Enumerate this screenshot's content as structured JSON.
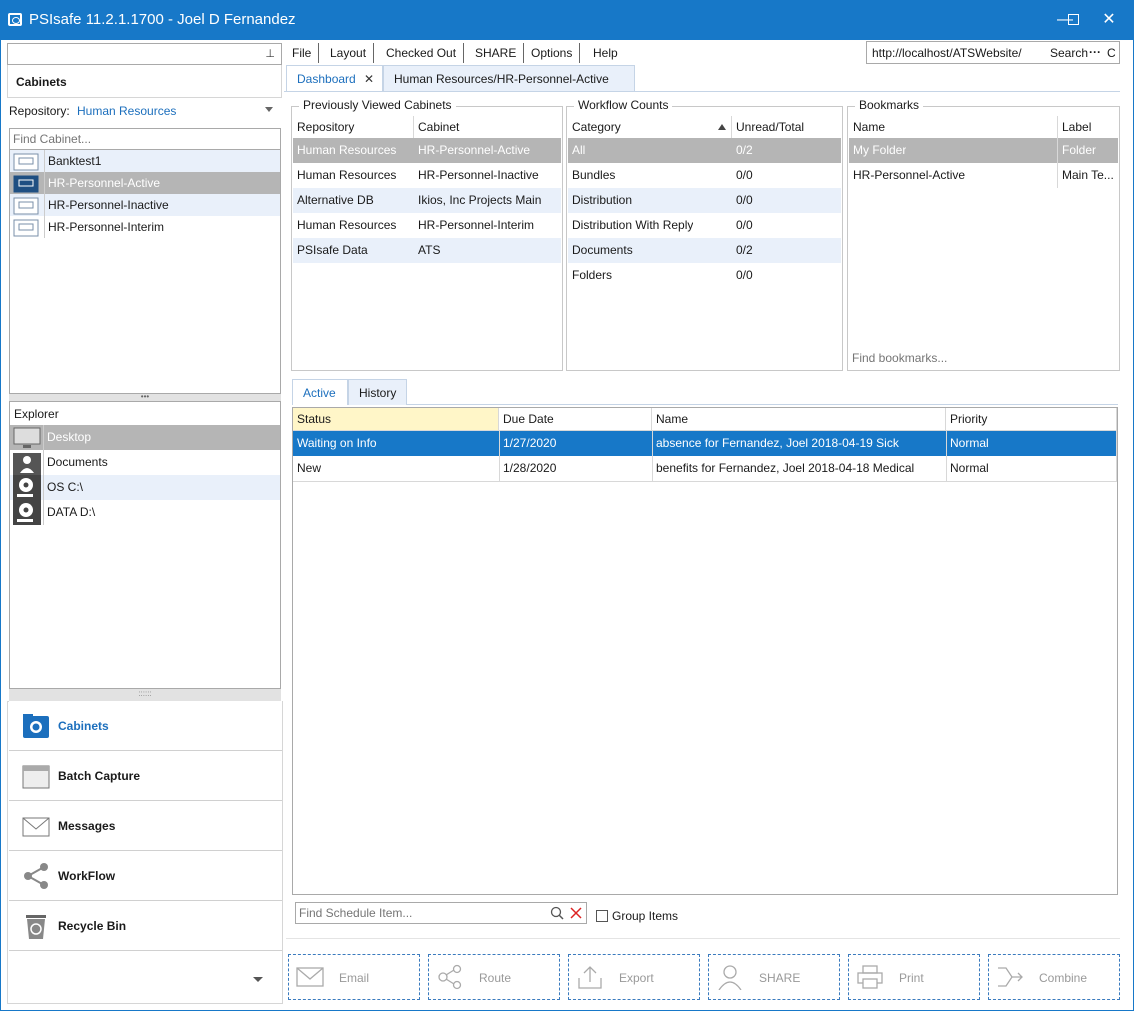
{
  "window": {
    "title": "PSIsafe 11.2.1.1700 - Joel D Fernandez",
    "minimize_glyph": "—",
    "maximize_glyph": "☐",
    "close_glyph": "✕"
  },
  "left_panel": {
    "pin_glyph": "📌",
    "cabinets_header": "Cabinets",
    "repository_label": "Repository:",
    "repository_value": "Human Resources",
    "find_cabinet_placeholder": "Find Cabinet...",
    "cabinets": [
      {
        "name": "Banktest1"
      },
      {
        "name": "HR-Personnel-Active"
      },
      {
        "name": "HR-Personnel-Inactive"
      },
      {
        "name": "HR-Personnel-Interim"
      }
    ],
    "explorer_header": "Explorer",
    "explorer_items": [
      {
        "name": "Desktop",
        "icon": "monitor-icon"
      },
      {
        "name": "Documents",
        "icon": "user-folder-icon"
      },
      {
        "name": "OS C:\\",
        "icon": "disk-icon"
      },
      {
        "name": "DATA D:\\",
        "icon": "disk-icon"
      }
    ],
    "nav_buttons": [
      {
        "label": "Cabinets",
        "icon": "cabinet-icon"
      },
      {
        "label": "Batch Capture",
        "icon": "scanner-icon"
      },
      {
        "label": "Messages",
        "icon": "envelope-icon"
      },
      {
        "label": "WorkFlow",
        "icon": "share-icon"
      },
      {
        "label": "Recycle Bin",
        "icon": "recycle-bin-icon"
      }
    ]
  },
  "menu": {
    "items": [
      "File",
      "Layout",
      "Checked Out",
      "SHARE",
      "Options",
      "Help"
    ],
    "url": "http://localhost/ATSWebsite/",
    "search_label": "Search",
    "more_glyph": "···",
    "c_glyph": "C"
  },
  "tabs": [
    {
      "label": "Dashboard",
      "close": "✕"
    },
    {
      "label": "Human Resources/HR-Personnel-Active"
    }
  ],
  "previously_viewed": {
    "title": "Previously Viewed Cabinets",
    "columns": [
      "Repository",
      "Cabinet"
    ],
    "rows": [
      [
        "Human Resources",
        "HR-Personnel-Active"
      ],
      [
        "Human Resources",
        "HR-Personnel-Inactive"
      ],
      [
        "Alternative DB",
        "Ikios, Inc Projects Main"
      ],
      [
        "Human Resources",
        "HR-Personnel-Interim"
      ],
      [
        "PSIsafe Data",
        "ATS"
      ]
    ]
  },
  "workflow_counts": {
    "title": "Workflow Counts",
    "columns": [
      "Category",
      "Unread/Total"
    ],
    "rows": [
      [
        "All",
        "0/2"
      ],
      [
        "Bundles",
        "0/0"
      ],
      [
        "Distribution",
        "0/0"
      ],
      [
        "Distribution With Reply",
        "0/0"
      ],
      [
        "Documents",
        "0/2"
      ],
      [
        "Folders",
        "0/0"
      ]
    ]
  },
  "bookmarks": {
    "title": "Bookmarks",
    "columns": [
      "Name",
      "Label"
    ],
    "rows": [
      [
        "My Folder",
        "Folder"
      ],
      [
        "HR-Personnel-Active",
        "Main Te..."
      ]
    ],
    "find_placeholder": "Find bookmarks..."
  },
  "schedule": {
    "tabs": [
      "Active",
      "History"
    ],
    "columns": [
      "Status",
      "Due Date",
      "Name",
      "Priority"
    ],
    "rows": [
      [
        "Waiting on Info",
        "1/27/2020",
        "absence for Fernandez, Joel 2018-04-19 Sick",
        "Normal"
      ],
      [
        "New",
        "1/28/2020",
        "benefits for Fernandez, Joel 2018-04-18 Medical",
        "Normal"
      ]
    ],
    "find_placeholder": "Find Schedule Item...",
    "group_items_label": "Group Items"
  },
  "actions": [
    {
      "label": "Email",
      "icon": "envelope-icon"
    },
    {
      "label": "Route",
      "icon": "share-icon"
    },
    {
      "label": "Export",
      "icon": "export-icon"
    },
    {
      "label": "SHARE",
      "icon": "user-icon"
    },
    {
      "label": "Print",
      "icon": "printer-icon"
    },
    {
      "label": "Combine",
      "icon": "combine-icon"
    }
  ],
  "colors": {
    "titlebar": "#1778c8",
    "accent": "#1c6fbd",
    "selected_gray": "#b5b5b5",
    "selected_blue": "#1778c8",
    "alt_row": "#e9f0fa"
  }
}
